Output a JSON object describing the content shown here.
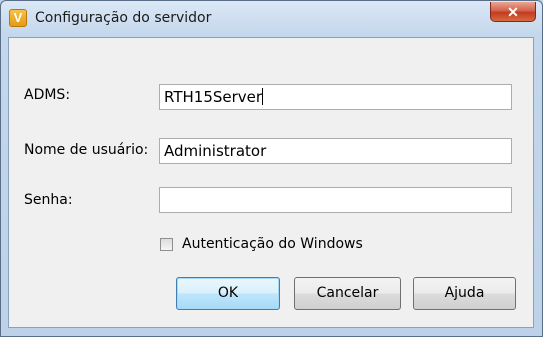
{
  "window": {
    "title": "Configuração do servidor",
    "icon_letter": "V",
    "close_symbol": "✕"
  },
  "form": {
    "adms_label": "ADMS:",
    "adms_value": "RTH15Server",
    "username_label": "Nome de usuário:",
    "username_value": "Administrator",
    "password_label": "Senha:",
    "password_value": "",
    "windows_auth_label": "Autenticação do Windows",
    "windows_auth_checked": false
  },
  "buttons": {
    "ok": "OK",
    "cancel": "Cancelar",
    "help": "Ajuda"
  }
}
